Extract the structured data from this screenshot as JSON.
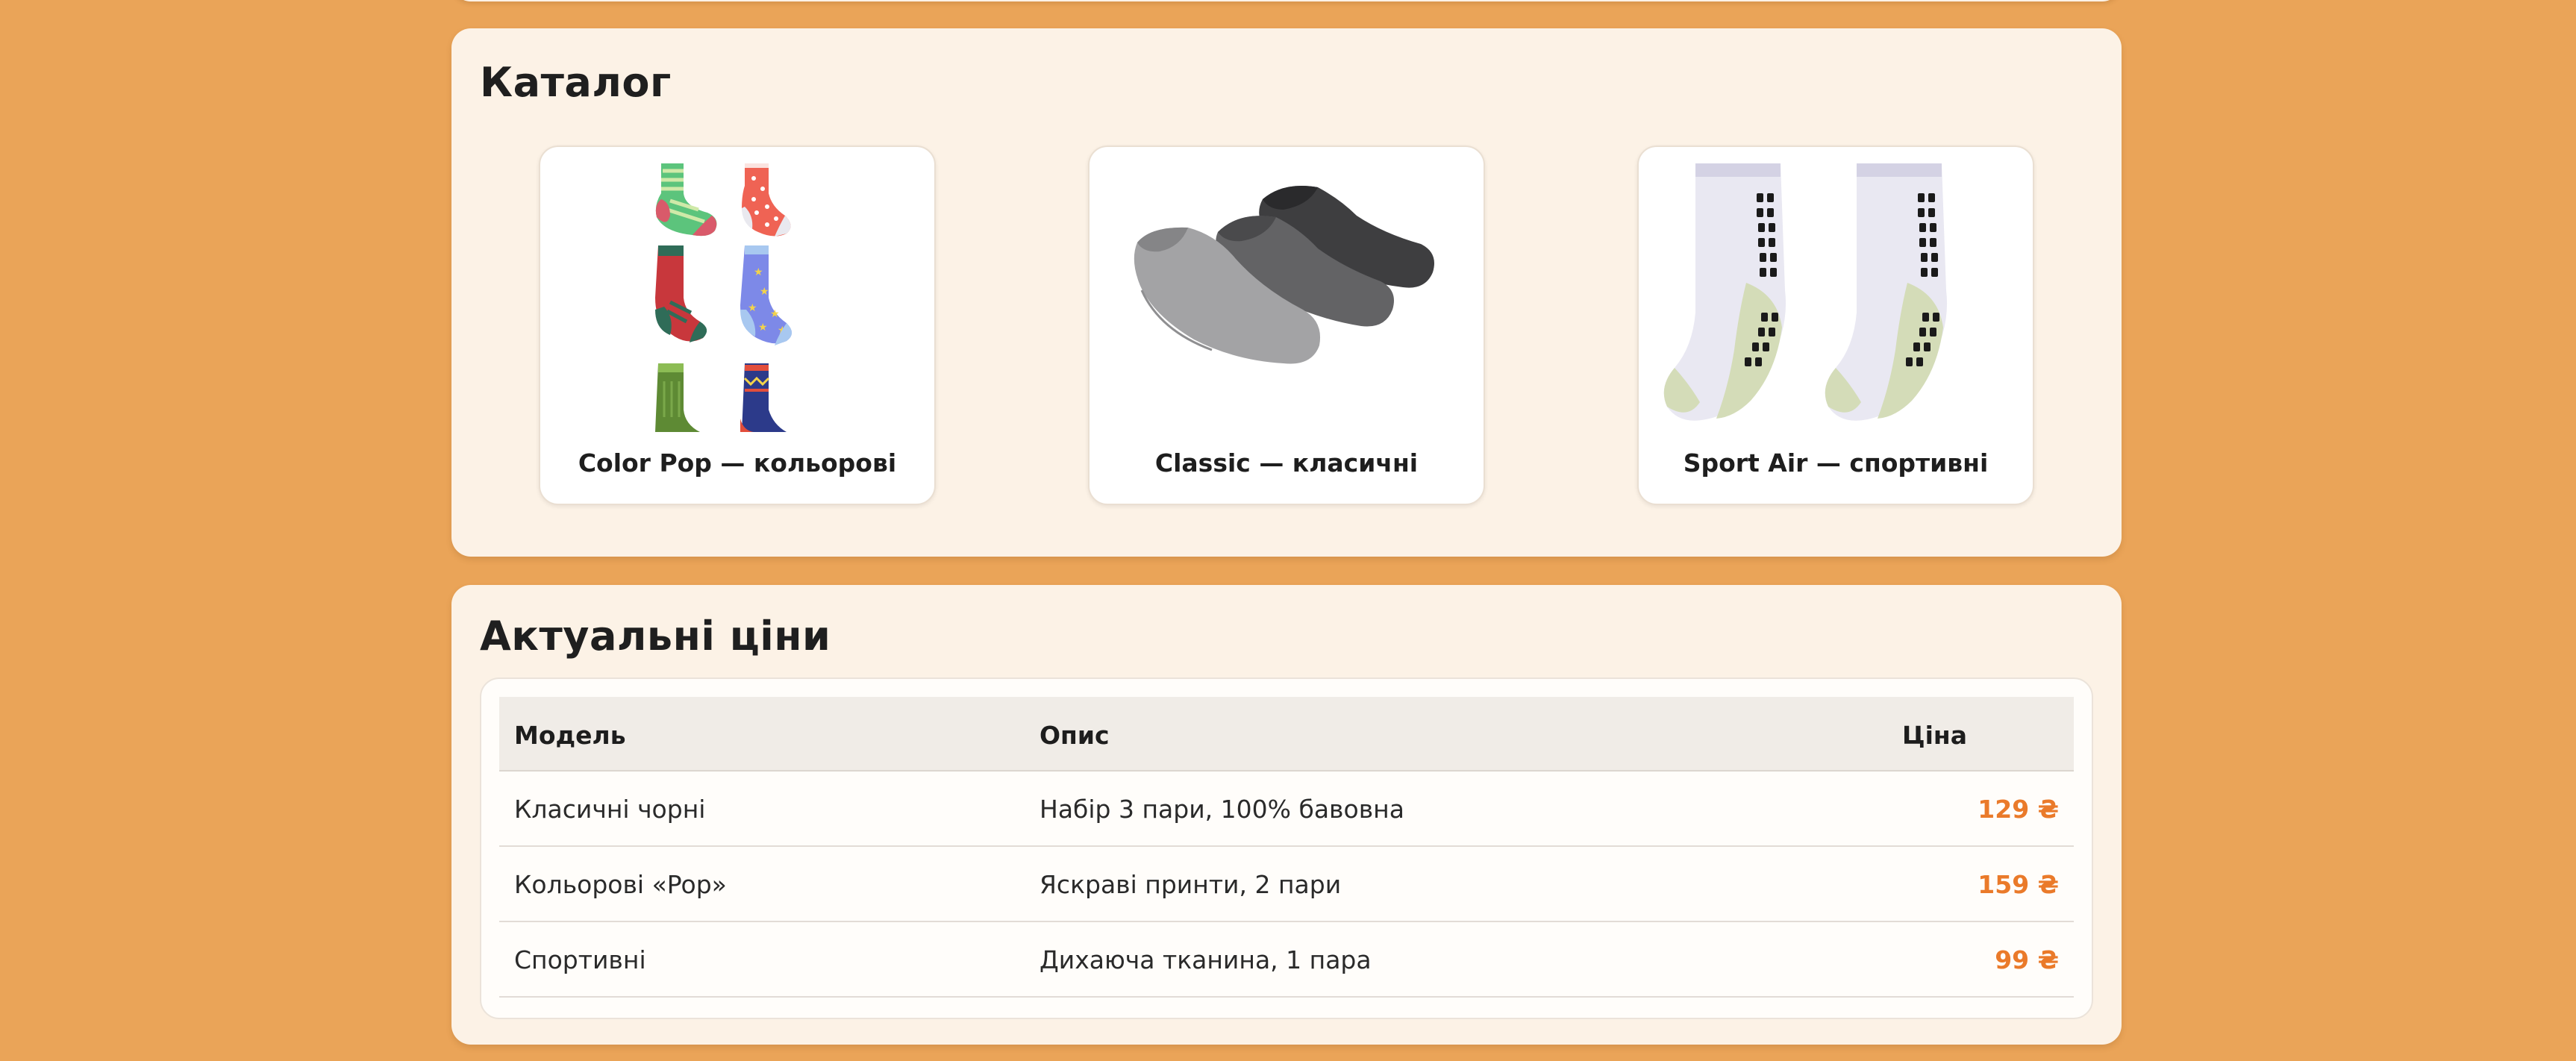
{
  "colors": {
    "page_background": "#eaa458",
    "card_background": "#fcf2e6",
    "price_accent": "#ea7a2a"
  },
  "catalog": {
    "title": "Каталог",
    "products": [
      {
        "name": "Color Pop — кольорові",
        "image_icon": "colorful-socks-image"
      },
      {
        "name": "Classic — класичні",
        "image_icon": "classic-grey-socks-image"
      },
      {
        "name": "Sport Air — спортивні",
        "image_icon": "sport-grip-socks-image"
      }
    ]
  },
  "prices": {
    "title": "Актуальні ціни",
    "columns": {
      "model": "Модель",
      "description": "Опис",
      "price": "Ціна"
    },
    "rows": [
      {
        "model": "Класичні чорні",
        "description": "Набір 3 пари, 100% бавовна",
        "price": "129 ₴"
      },
      {
        "model": "Кольорові «Pop»",
        "description": "Яскраві принти, 2 пари",
        "price": "159 ₴"
      },
      {
        "model": "Спортивні",
        "description": "Дихаюча тканина, 1 пара",
        "price": "99 ₴"
      }
    ]
  }
}
